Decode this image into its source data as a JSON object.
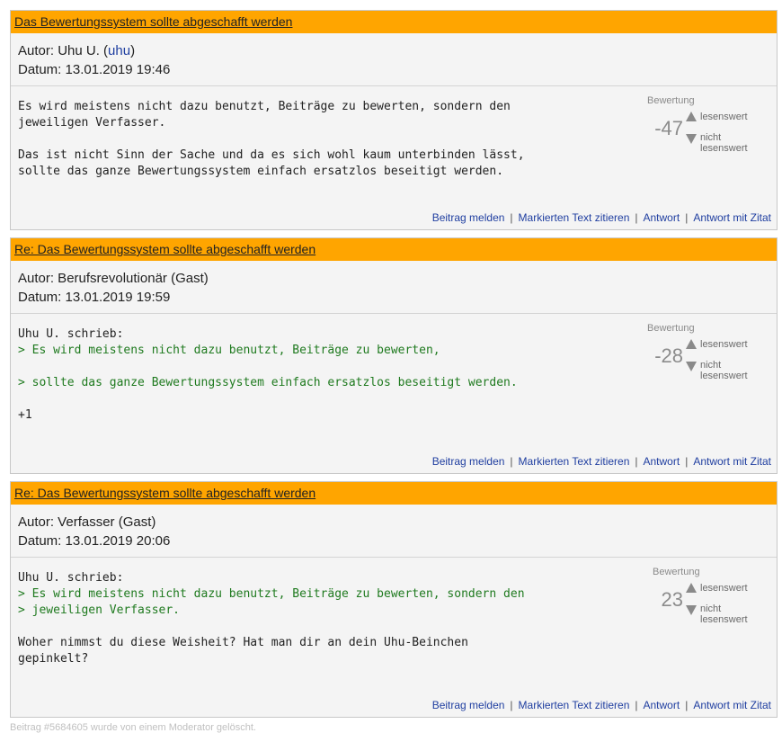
{
  "posts": [
    {
      "title": "Das Bewertungssystem sollte abgeschafft werden",
      "author_prefix": "Autor: ",
      "author_name": "Uhu U.",
      "author_user": "uhu",
      "date_line": "Datum: 13.01.2019 19:46",
      "lines": [
        {
          "text": "Es wird meistens nicht dazu benutzt, Beiträge zu bewerten, sondern den",
          "quote": false
        },
        {
          "text": "jeweiligen Verfasser.",
          "quote": false
        },
        {
          "text": "",
          "quote": false
        },
        {
          "text": "Das ist nicht Sinn der Sache und da es sich wohl kaum unterbinden lässt,",
          "quote": false
        },
        {
          "text": "sollte das ganze Bewertungssystem einfach ersatzlos beseitigt werden.",
          "quote": false
        }
      ],
      "rating": {
        "title": "Bewertung",
        "value": "-47",
        "up_label": "lesenswert",
        "down_label": "nicht lesenswert"
      }
    },
    {
      "title": "Re: Das Bewertungssystem sollte abgeschafft werden",
      "author_line": "Autor: Berufsrevolutionär (Gast)",
      "date_line": "Datum: 13.01.2019 19:59",
      "lines": [
        {
          "text": "Uhu U. schrieb:",
          "quote": false
        },
        {
          "text": "> Es wird meistens nicht dazu benutzt, Beiträge zu bewerten,",
          "quote": true
        },
        {
          "text": "",
          "quote": false
        },
        {
          "text": "> sollte das ganze Bewertungssystem einfach ersatzlos beseitigt werden.",
          "quote": true
        },
        {
          "text": "",
          "quote": false
        },
        {
          "text": "+1",
          "quote": false
        }
      ],
      "rating": {
        "title": "Bewertung",
        "value": "-28",
        "up_label": "lesenswert",
        "down_label": "nicht lesenswert"
      }
    },
    {
      "title": "Re: Das Bewertungssystem sollte abgeschafft werden",
      "author_line": "Autor: Verfasser (Gast)",
      "date_line": "Datum: 13.01.2019 20:06",
      "lines": [
        {
          "text": "Uhu U. schrieb:",
          "quote": false
        },
        {
          "text": "> Es wird meistens nicht dazu benutzt, Beiträge zu bewerten, sondern den",
          "quote": true
        },
        {
          "text": "> jeweiligen Verfasser.",
          "quote": true
        },
        {
          "text": "",
          "quote": false
        },
        {
          "text": "Woher nimmst du diese Weisheit? Hat man dir an dein Uhu-Beinchen",
          "quote": false
        },
        {
          "text": "gepinkelt?",
          "quote": false
        }
      ],
      "rating": {
        "title": "Bewertung",
        "value": "23",
        "up_label": "lesenswert",
        "down_label": "nicht lesenswert"
      }
    }
  ],
  "actions": {
    "report": "Beitrag melden",
    "quote_selected": "Markierten Text zitieren",
    "reply": "Antwort",
    "reply_quote": "Antwort mit Zitat",
    "separator": "|"
  },
  "footer_note": "Beitrag #5684605 wurde von einem Moderator gelöscht."
}
